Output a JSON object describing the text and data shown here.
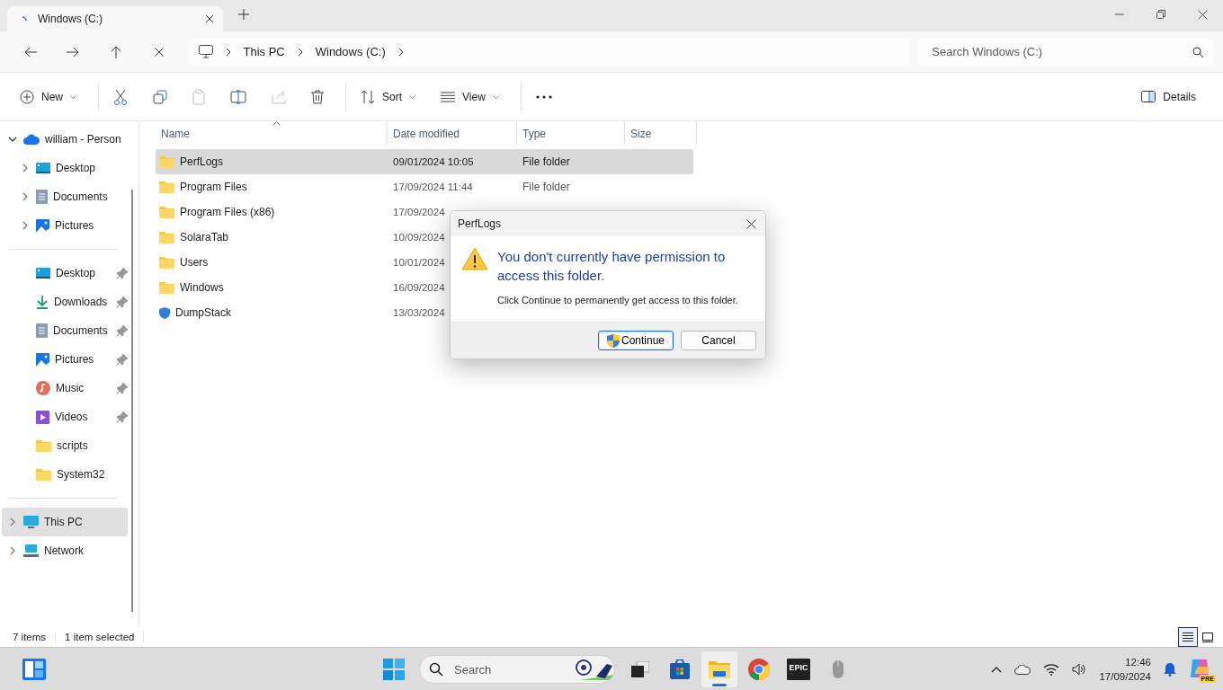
{
  "tab": {
    "title": "Windows (C:)"
  },
  "address": {
    "crumbs": [
      "This PC",
      "Windows (C:)"
    ],
    "search_placeholder": "Search Windows (C:)"
  },
  "toolbar": {
    "items": [
      {
        "kind": "new",
        "label": "New",
        "disabled": false
      },
      {
        "kind": "cut",
        "disabled": false
      },
      {
        "kind": "copy",
        "disabled": false
      },
      {
        "kind": "paste",
        "disabled": true
      },
      {
        "kind": "rename",
        "disabled": false
      },
      {
        "kind": "share",
        "disabled": true
      },
      {
        "kind": "delete",
        "disabled": false
      },
      {
        "kind": "sort",
        "label": "Sort",
        "disabled": false
      },
      {
        "kind": "view",
        "label": "View",
        "disabled": false
      },
      {
        "kind": "more",
        "disabled": false
      }
    ],
    "details_label": "Details"
  },
  "sidebar": {
    "tree": [
      {
        "label": "william - Person",
        "kind": "cloud",
        "expanded": true,
        "selected": false,
        "children": [
          {
            "label": "Desktop",
            "kind": "desktop",
            "expanded": false,
            "selected": false
          },
          {
            "label": "Documents",
            "kind": "documents",
            "expanded": false,
            "selected": false
          },
          {
            "label": "Pictures",
            "kind": "pictures",
            "expanded": false,
            "selected": false
          }
        ]
      }
    ],
    "quick_access": [
      {
        "label": "Desktop",
        "kind": "desktop",
        "pinned": true,
        "selected": false
      },
      {
        "label": "Downloads",
        "kind": "downloads",
        "pinned": true,
        "selected": false
      },
      {
        "label": "Documents",
        "kind": "documents",
        "pinned": true,
        "selected": false
      },
      {
        "label": "Pictures",
        "kind": "pictures",
        "pinned": true,
        "selected": false
      },
      {
        "label": "Music",
        "kind": "music",
        "pinned": true,
        "selected": false
      },
      {
        "label": "Videos",
        "kind": "videos",
        "pinned": true,
        "selected": false
      },
      {
        "label": "scripts",
        "kind": "folder",
        "pinned": false,
        "selected": false
      },
      {
        "label": "System32",
        "kind": "folder",
        "pinned": false,
        "selected": false
      }
    ],
    "drives": [
      {
        "label": "This PC",
        "kind": "pc",
        "expanded": false,
        "selected": true
      },
      {
        "label": "Network",
        "kind": "network",
        "expanded": false,
        "selected": false
      }
    ]
  },
  "table": {
    "columns": [
      "Name",
      "Date modified",
      "Type",
      "Size"
    ],
    "rows": [
      {
        "kind": "folder",
        "name": "PerfLogs",
        "date": "09/01/2024 10:05",
        "type": "File folder",
        "selected": true
      },
      {
        "kind": "folder",
        "name": "Program Files",
        "date": "17/09/2024 11:44",
        "type": "File folder",
        "selected": false
      },
      {
        "kind": "folder",
        "name": "Program Files (x86)",
        "date": "17/09/2024",
        "selected": false
      },
      {
        "kind": "folder",
        "name": "SolaraTab",
        "date": "10/09/2024",
        "selected": false
      },
      {
        "kind": "folder",
        "name": "Users",
        "date": "10/01/2024",
        "selected": false
      },
      {
        "kind": "folder",
        "name": "Windows",
        "date": "16/09/2024",
        "selected": false
      },
      {
        "kind": "shield",
        "name": "DumpStack",
        "date": "13/03/2024",
        "selected": false
      }
    ]
  },
  "dialog": {
    "title": "PerfLogs",
    "message": "You don't currently have permission to access this folder.",
    "detail": "Click Continue to permanently get access to this folder.",
    "buttons": [
      {
        "label": "Continue",
        "kind": "shield",
        "default": true
      },
      {
        "label": "Cancel",
        "kind": "plain",
        "default": false
      }
    ]
  },
  "status_bar": {
    "items": [
      "7 items",
      "1 item selected"
    ],
    "views": [
      {
        "kind": "details",
        "selected": true
      },
      {
        "kind": "tiles",
        "selected": false
      }
    ]
  },
  "taskbar": {
    "apps": [
      {
        "kind": "start",
        "active": false
      },
      {
        "kind": "search",
        "label": "Search",
        "active": false
      },
      {
        "kind": "taskview",
        "active": false
      },
      {
        "kind": "store",
        "active": false
      },
      {
        "kind": "explorer",
        "active": true
      },
      {
        "kind": "chrome",
        "active": false
      },
      {
        "kind": "epic",
        "label": "EPIC",
        "active": false
      },
      {
        "kind": "mouse",
        "active": false
      }
    ],
    "time": "12:46",
    "date": "17/09/2024",
    "copilot_badge": "PRE"
  }
}
